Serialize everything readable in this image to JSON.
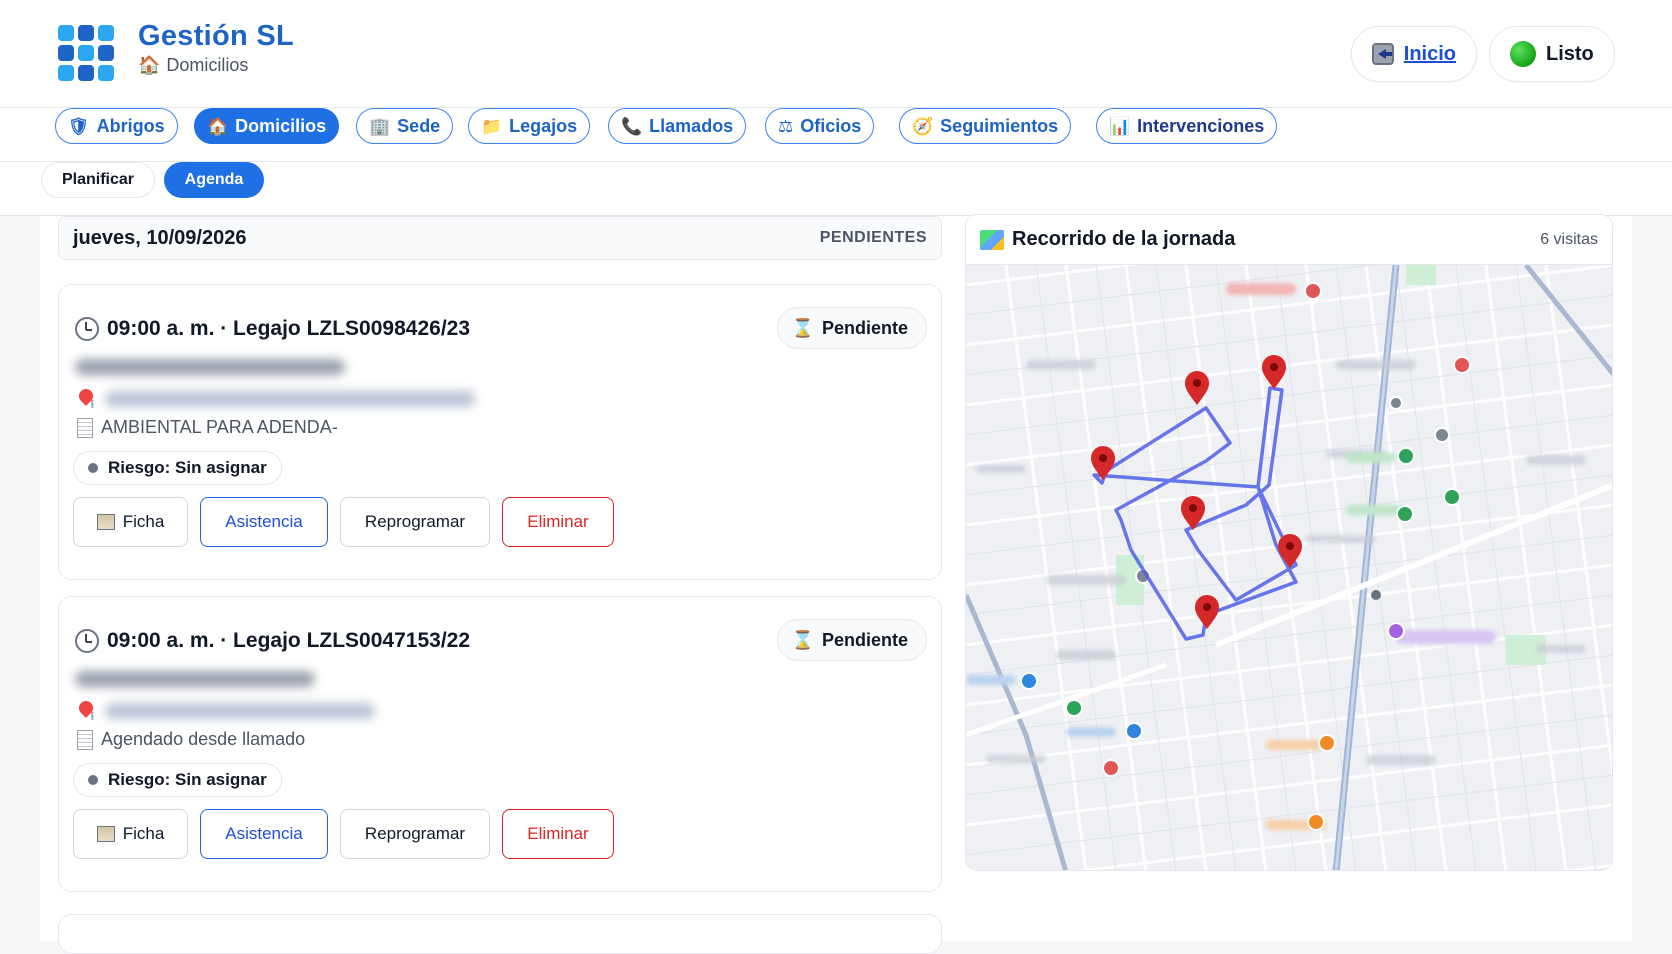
{
  "app": {
    "title": "Gestión SL",
    "subtitle": "Domicilios",
    "subtitle_icon": "house-icon"
  },
  "header": {
    "inicio_label": "Inicio",
    "listo_label": "Listo"
  },
  "tabs": [
    {
      "label": "Abrigos",
      "icon": "shield-icon",
      "glyph": "🛡"
    },
    {
      "label": "Domicilios",
      "icon": "house-icon",
      "glyph": "🏠",
      "active": true
    },
    {
      "label": "Sede",
      "icon": "building-icon",
      "glyph": "🏢"
    },
    {
      "label": "Legajos",
      "icon": "folder-icon",
      "glyph": "📁"
    },
    {
      "label": "Llamados",
      "icon": "phone-icon",
      "glyph": "📞"
    },
    {
      "label": "Oficios",
      "icon": "scales-icon",
      "glyph": "⚖"
    },
    {
      "label": "Seguimientos",
      "icon": "compass-icon",
      "glyph": "🧭"
    },
    {
      "label": "Intervenciones",
      "icon": "bar-chart-icon",
      "glyph": "📊"
    }
  ],
  "subtabs": {
    "planificar": "Planificar",
    "agenda": "Agenda"
  },
  "agenda": {
    "date": "jueves, 10/09/2026",
    "status": "PENDIENTES",
    "items": [
      {
        "title": "09:00 a. m. · Legajo LZLS0098426/23",
        "status": "Pendiente",
        "note": "AMBIENTAL PARA ADENDA-",
        "risk": "Riesgo: Sin asignar",
        "buttons": {
          "ficha": "Ficha",
          "asistencia": "Asistencia",
          "reprogramar": "Reprogramar",
          "eliminar": "Eliminar"
        }
      },
      {
        "title": "09:00 a. m. · Legajo LZLS0047153/22",
        "status": "Pendiente",
        "note": "Agendado desde llamado",
        "risk": "Riesgo: Sin asignar",
        "buttons": {
          "ficha": "Ficha",
          "asistencia": "Asistencia",
          "reprogramar": "Reprogramar",
          "eliminar": "Eliminar"
        }
      }
    ]
  },
  "map": {
    "title": "Recorrido de la jornada",
    "count": "6 visitas",
    "route_color": "#4f5fe8",
    "marker_color": "#d62828"
  },
  "colors": {
    "brand": "#1e63c6",
    "accent": "#1f6fe5",
    "danger": "#dc2626"
  }
}
